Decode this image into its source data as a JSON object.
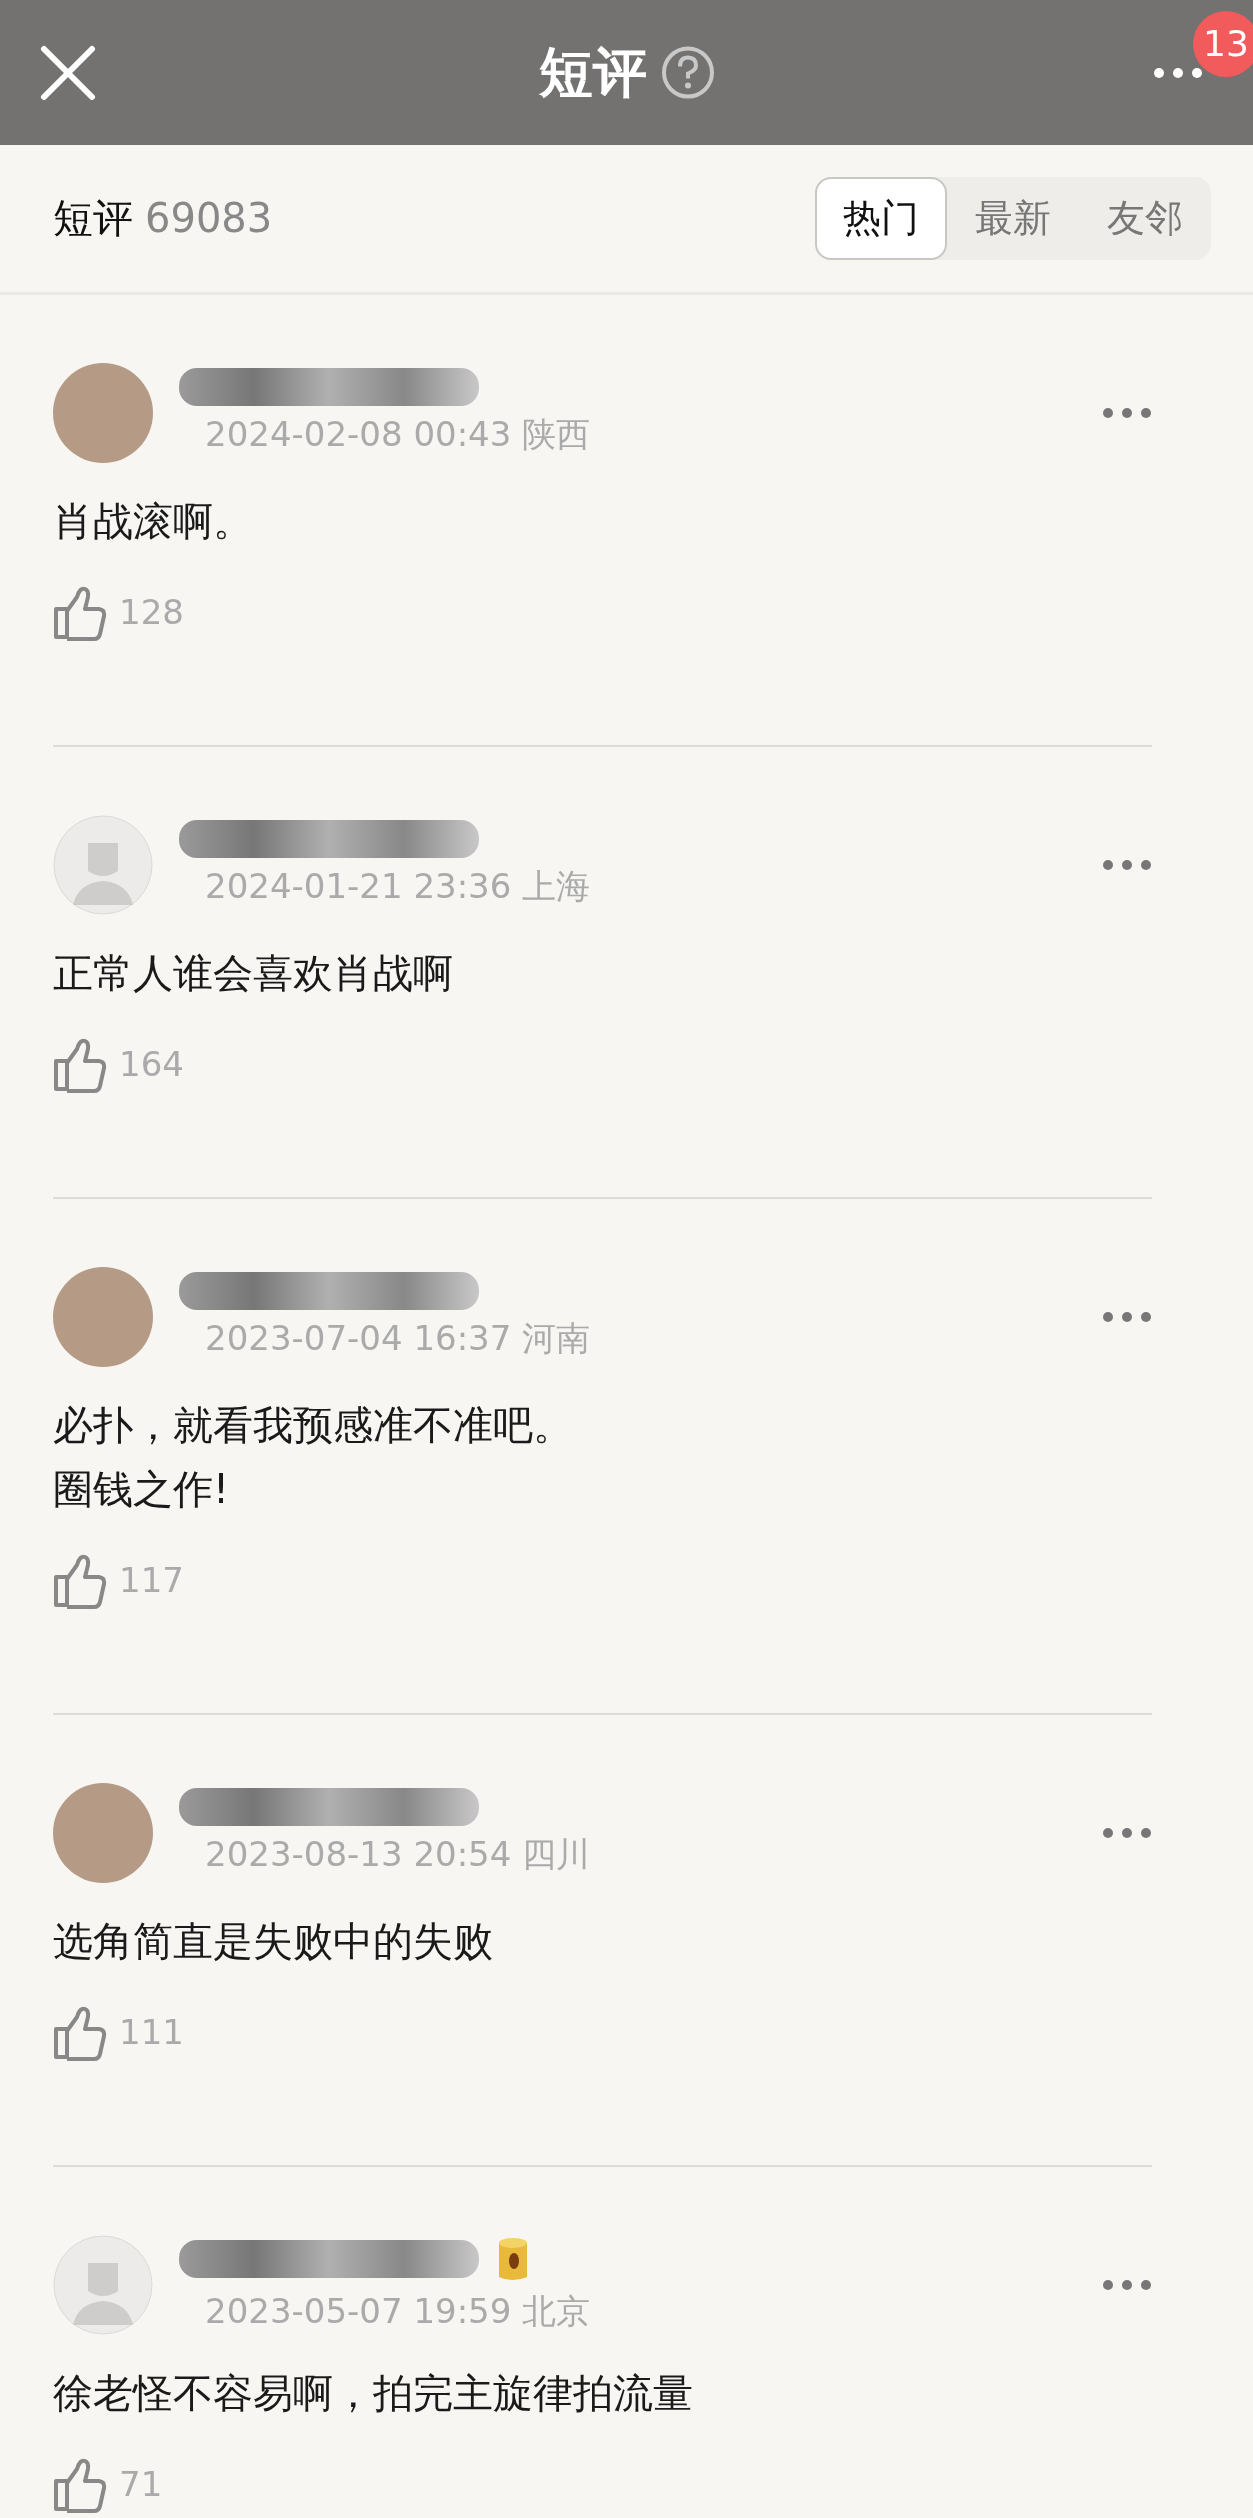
{
  "header": {
    "title": "短评",
    "badge": "13"
  },
  "summary": {
    "label": "短评",
    "count": "69083"
  },
  "tabs": [
    {
      "label": "热门",
      "selected": true
    },
    {
      "label": "最新",
      "selected": false
    },
    {
      "label": "友邻",
      "selected": false
    }
  ],
  "comments": [
    {
      "kind": "photo",
      "name_hidden": true,
      "badge": false,
      "meta": "2024-02-08 00:43 陕西",
      "lines": [
        "肖战滚啊。"
      ],
      "likes": "128"
    },
    {
      "kind": "default",
      "name_hidden": true,
      "badge": false,
      "meta": "2024-01-21 23:36 上海",
      "lines": [
        "正常人谁会喜欢肖战啊"
      ],
      "likes": "164"
    },
    {
      "kind": "photo",
      "name_hidden": true,
      "badge": false,
      "meta": "2023-07-04 16:37 河南",
      "lines": [
        "必扑，就看我预感准不准吧。",
        "圈钱之作!"
      ],
      "likes": "117"
    },
    {
      "kind": "photo",
      "name_hidden": true,
      "badge": false,
      "meta": "2023-08-13 20:54 四川",
      "lines": [
        "选角简直是失败中的失败"
      ],
      "likes": "111"
    },
    {
      "kind": "default",
      "name_hidden": true,
      "badge": true,
      "meta": "2023-05-07 19:59 北京",
      "lines": [
        "徐老怪不容易啊，拍完主旋律拍流量"
      ],
      "likes": "71"
    }
  ]
}
